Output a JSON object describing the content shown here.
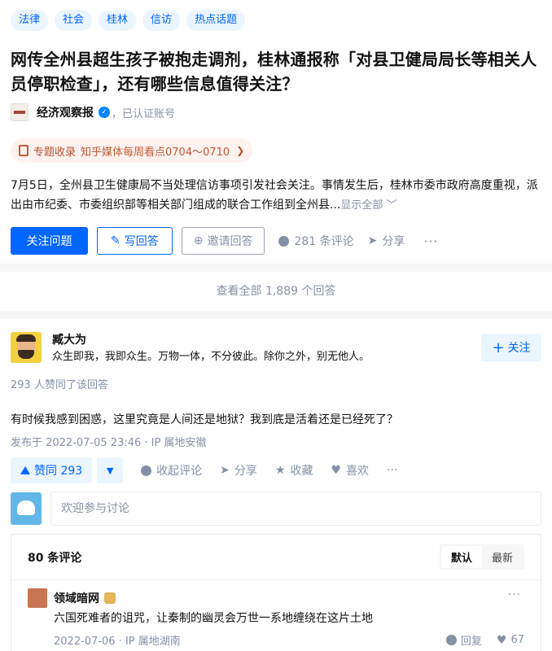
{
  "question": {
    "tags": [
      "法律",
      "社会",
      "桂林",
      "信访",
      "热点话题"
    ],
    "title": "网传全州县超生孩子被抱走调剂，桂林通报称「对县卫健局局长等相关人员停职检查」，还有哪些信息值得关注？",
    "author": "经济观察报",
    "verified_text": "，已认证账号",
    "collection_label": "专题收录",
    "collection_title": "知乎媒体每周看点0704～0710",
    "collection_chevron": "❯",
    "excerpt": "7月5日，全州县卫生健康局不当处理信访事项引发社会关注。事情发生后，桂林市委市政府高度重视，派出由市纪委、市委组织部等相关部门组成的联合工作组到全州县...",
    "show_all": "显示全部 ﹀",
    "follow_label": "关注问题",
    "write_label": "写回答",
    "invite_label": "邀请回答",
    "comments_label": "281 条评论",
    "share_label": "分享",
    "more": "···"
  },
  "view_all": "查看全部 1,889 个回答",
  "answer": {
    "author": "臧大为",
    "bio": "众生即我，我即众生。万物一体，不分彼此。除你之外，别无他人。",
    "follow_label": "关注",
    "upvote_line": "293 人赞同了该回答",
    "content": "有时候我感到困惑，这里究竟是人间还是地狱？我到底是活着还是已经死了？",
    "published": "发布于 2022-07-05 23:46 · IP 属地安徽",
    "vote_label": "赞同 293",
    "collapse_comments": "收起评论",
    "share": "分享",
    "collect": "收藏",
    "like": "喜欢",
    "more": "···",
    "comment_placeholder": "欢迎参与讨论"
  },
  "comments": {
    "count_label": "80 条评论",
    "sort": [
      "默认",
      "最新"
    ],
    "items": [
      {
        "name": "领域暗网",
        "text": "六国死难者的诅咒，让秦制的幽灵会万世一系地缠绕在这片土地",
        "meta": "2022-07-06 · IP 属地湖南",
        "reply": "回复",
        "likes": "67",
        "more": "···"
      }
    ]
  }
}
